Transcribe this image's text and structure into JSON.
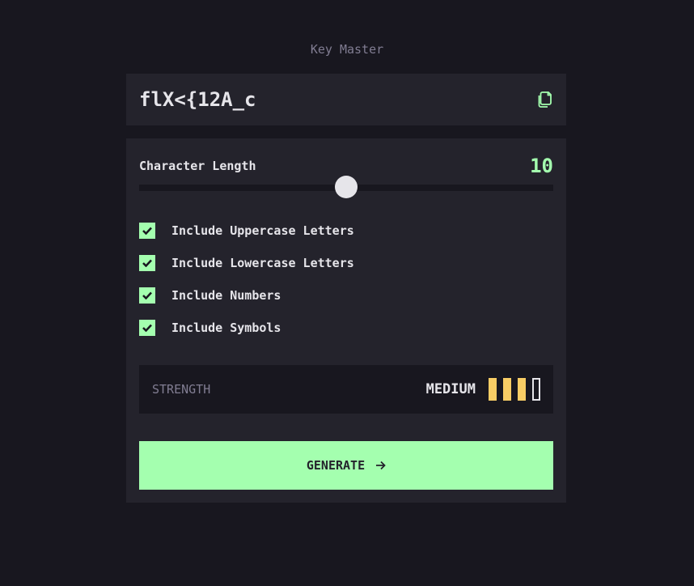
{
  "app": {
    "title": "Key Master"
  },
  "output": {
    "password": "flX<{12A_c",
    "copy_icon": "copy-icon"
  },
  "length": {
    "label": "Character Length",
    "value": "10",
    "min": 0,
    "max": 20
  },
  "options": [
    {
      "label": "Include Uppercase Letters",
      "checked": true
    },
    {
      "label": "Include Lowercase Letters",
      "checked": true
    },
    {
      "label": "Include Numbers",
      "checked": true
    },
    {
      "label": "Include Symbols",
      "checked": true
    }
  ],
  "strength": {
    "label": "STRENGTH",
    "value": "MEDIUM",
    "level": 3,
    "bars_total": 4,
    "color": "#f8cd65"
  },
  "generate": {
    "label": "GENERATE",
    "icon": "arrow-right-icon"
  },
  "colors": {
    "background": "#18171f",
    "panel": "#24232c",
    "accent": "#a4ffaf",
    "text": "#e6e5ea",
    "muted": "#817d92"
  }
}
